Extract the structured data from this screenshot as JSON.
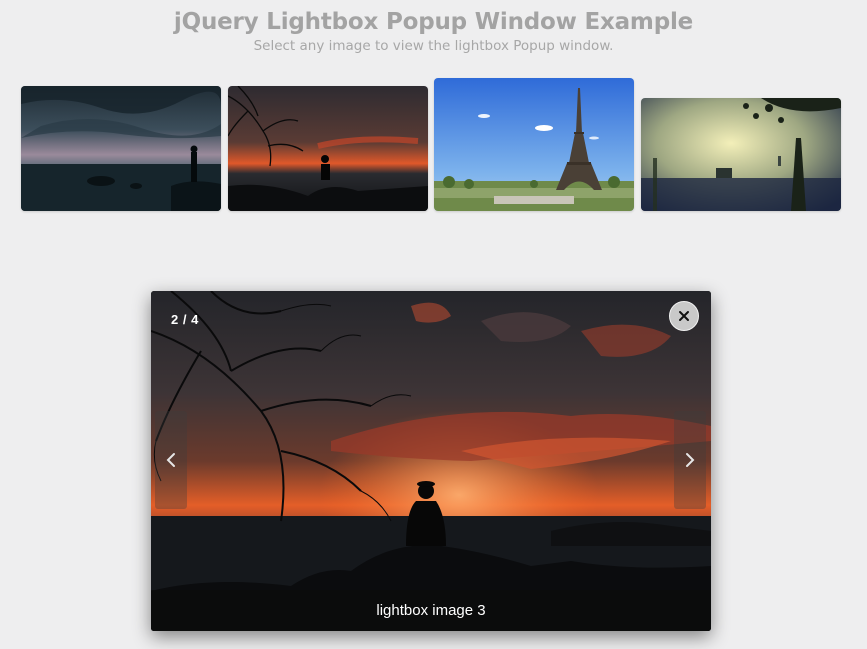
{
  "page": {
    "title": "jQuery Lightbox Popup Window Example",
    "subtitle": "Select any image to view the lightbox Popup window."
  },
  "gallery": {
    "thumbnails": [
      {
        "icon": "seaside-dusk-image"
      },
      {
        "icon": "tree-sunset-image"
      },
      {
        "icon": "eiffel-tower-image"
      },
      {
        "icon": "misty-park-image"
      }
    ]
  },
  "lightbox": {
    "counter": "2 / 4",
    "caption": "lightbox image 3",
    "close_icon": "close-icon",
    "prev_icon": "chevron-left-icon",
    "next_icon": "chevron-right-icon"
  }
}
